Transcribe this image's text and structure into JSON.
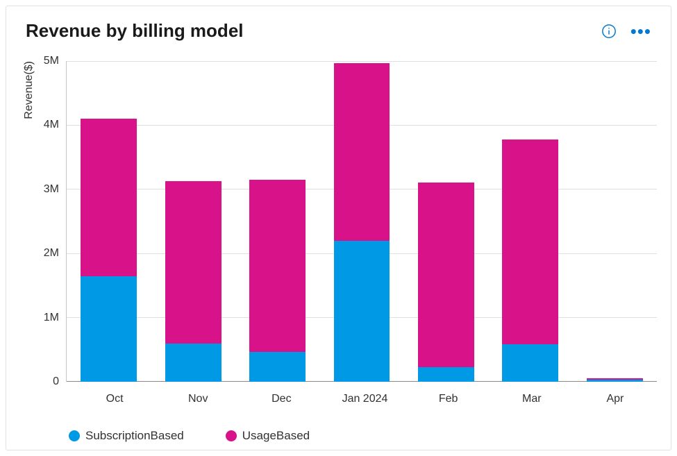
{
  "card": {
    "title": "Revenue by billing model"
  },
  "chart_data": {
    "type": "bar",
    "stacked": true,
    "categories": [
      "Oct",
      "Nov",
      "Dec",
      "Jan 2024",
      "Feb",
      "Mar",
      "Apr"
    ],
    "series": [
      {
        "name": "SubscriptionBased",
        "color": "#0099e6",
        "values": [
          1650000,
          600000,
          470000,
          2200000,
          230000,
          580000,
          30000
        ]
      },
      {
        "name": "UsageBased",
        "color": "#d8138a",
        "values": [
          2450000,
          2530000,
          2680000,
          2770000,
          2880000,
          3200000,
          20000
        ]
      }
    ],
    "ylabel": "Revenue($)",
    "ylim": [
      0,
      5000000
    ],
    "yticks_labels": [
      "5M",
      "4M",
      "3M",
      "2M",
      "1M",
      "0"
    ],
    "yticks_values": [
      5000000,
      4000000,
      3000000,
      2000000,
      1000000,
      0
    ]
  },
  "legend": {
    "items": [
      {
        "label": "SubscriptionBased"
      },
      {
        "label": "UsageBased"
      }
    ]
  }
}
